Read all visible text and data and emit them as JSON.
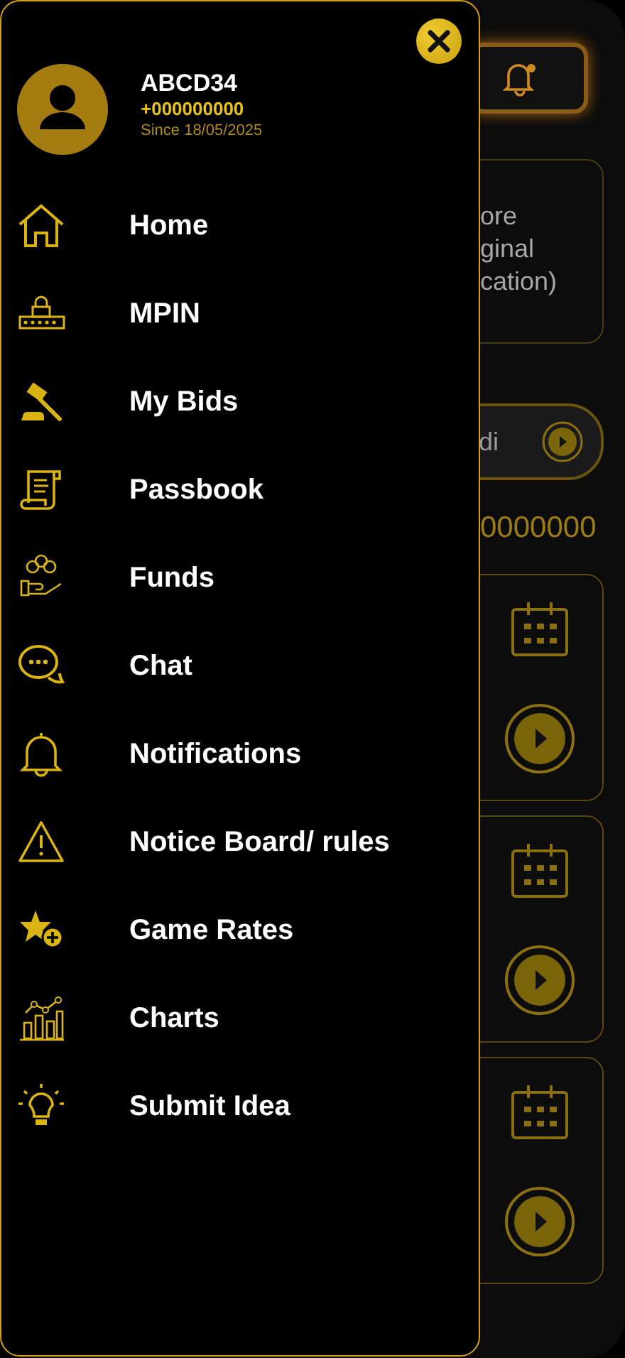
{
  "background": {
    "card_text": [
      "ore",
      "ginal",
      "cation)"
    ],
    "pill_text": "di",
    "amount": "0000000",
    "game_cards": [
      {
        "kind": "game"
      },
      {
        "kind": "game"
      },
      {
        "kind": "game"
      }
    ]
  },
  "drawer": {
    "user": {
      "name": "ABCD34",
      "phone": "+000000000",
      "since": "Since 18/05/2025"
    },
    "items": [
      {
        "label": "Home"
      },
      {
        "label": "MPIN"
      },
      {
        "label": "My Bids"
      },
      {
        "label": "Passbook"
      },
      {
        "label": "Funds"
      },
      {
        "label": "Chat"
      },
      {
        "label": "Notifications"
      },
      {
        "label": "Notice Board/ rules"
      },
      {
        "label": "Game Rates"
      },
      {
        "label": "Charts"
      },
      {
        "label": "Submit Idea"
      }
    ]
  }
}
